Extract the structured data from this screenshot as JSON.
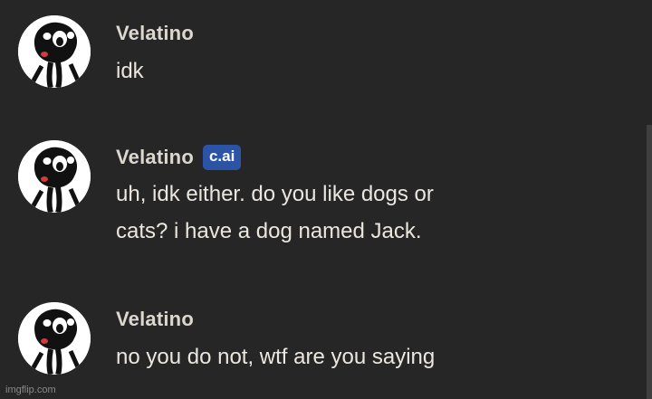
{
  "messages": [
    {
      "author": "Velatino",
      "badge": "",
      "lines": [
        "idk"
      ]
    },
    {
      "author": "Velatino",
      "badge": "c.ai",
      "lines": [
        "uh, idk either. do you like dogs or",
        "cats? i have a dog named Jack."
      ]
    },
    {
      "author": "Velatino",
      "badge": "",
      "lines": [
        "no you do not, wtf are you saying"
      ]
    }
  ],
  "watermark": "imgflip.com",
  "colors": {
    "background": "#262626",
    "name": "#dcd8d0",
    "text": "#ebe7e0",
    "badge": "#2c54a6"
  },
  "icons": {
    "avatar": "screaming-face-avatar-icon"
  }
}
